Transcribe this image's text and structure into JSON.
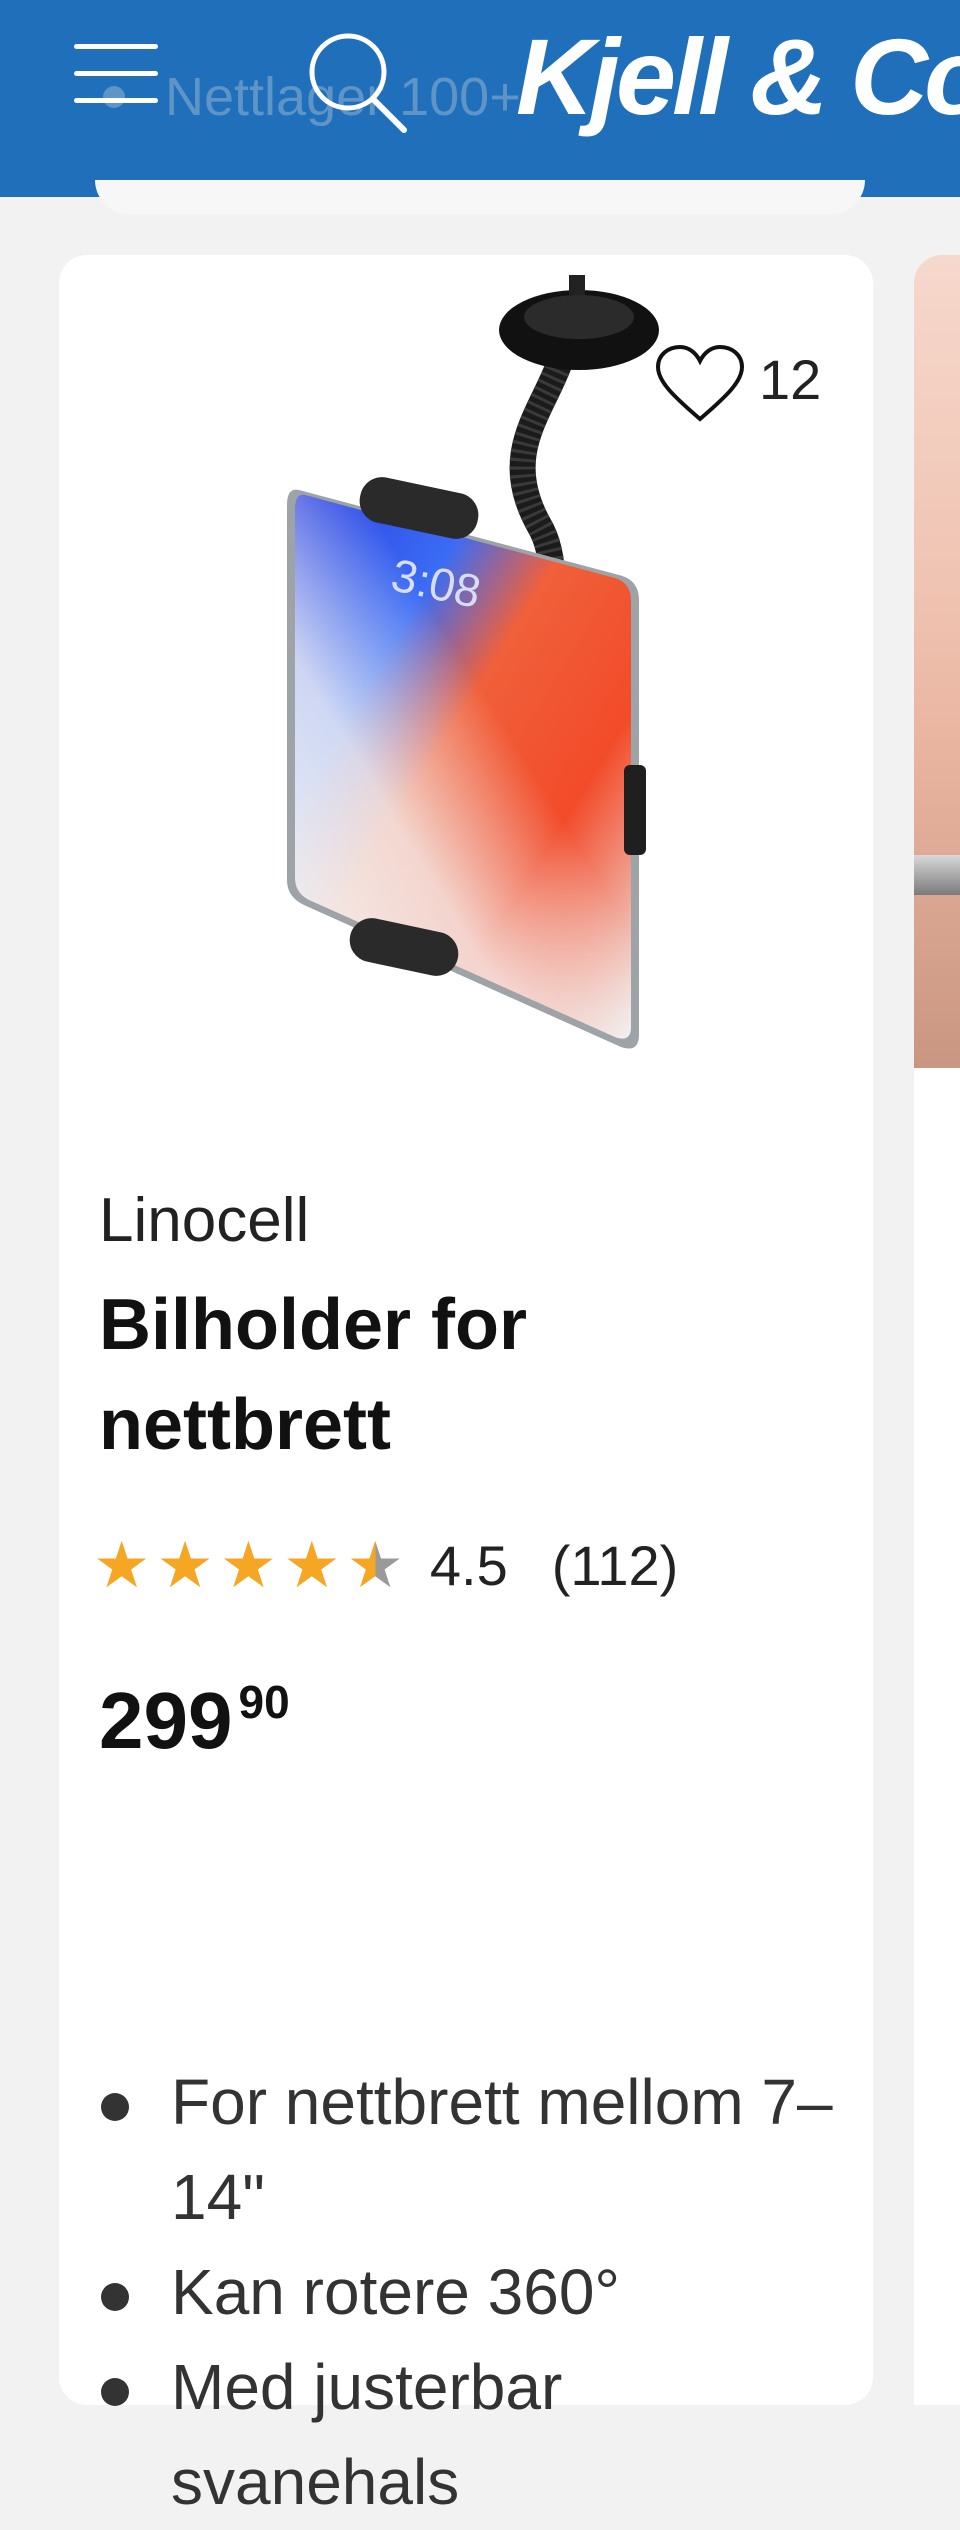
{
  "header": {
    "logo": "Kjell & Company",
    "ghost_status": "Nettlager 100+",
    "menu_icon": "hamburger-icon",
    "search_icon": "search-icon",
    "background_color": "#1f6fbb"
  },
  "product": {
    "favorite_icon": "heart-icon",
    "favorite_count": "12",
    "brand": "Linocell",
    "title": "Bilholder for nettbrett",
    "rating": {
      "value": 4.5,
      "value_text": "4.5",
      "count_text": "(112)",
      "star_color": "#f5a623"
    },
    "price": {
      "main": "299",
      "decimals": "90"
    },
    "features": [
      "For nettbrett mellom 7–14\"",
      "Kan rotere 360°",
      "Med justerbar svanehals"
    ],
    "image_icon": "tablet-car-holder-image"
  }
}
